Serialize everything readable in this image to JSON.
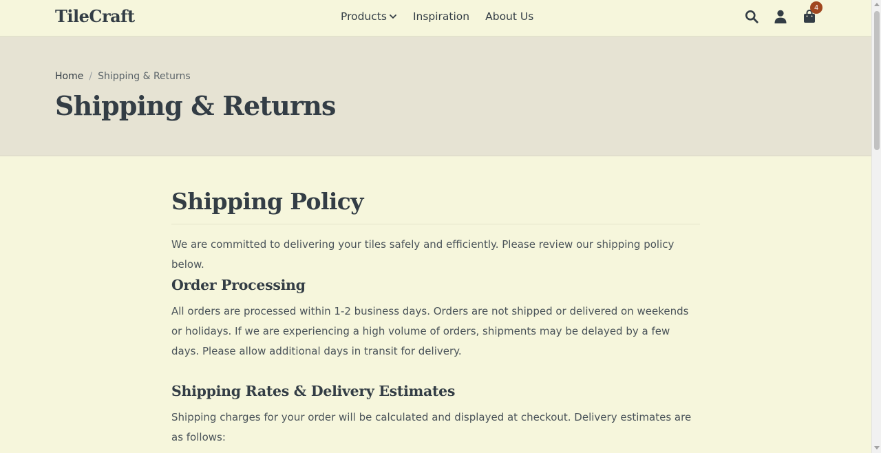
{
  "header": {
    "logo": "TileCraft",
    "nav": [
      "Products",
      "Inspiration",
      "About Us"
    ],
    "cart_count": "4",
    "icons": [
      "search-icon",
      "user-icon",
      "shopping-bag-icon",
      "chevron-down-icon"
    ]
  },
  "hero": {
    "breadcrumb": {
      "home": "Home",
      "separator": "/",
      "current": "Shipping & Returns"
    },
    "title": "Shipping & Returns"
  },
  "content": {
    "heading": "Shipping Policy",
    "intro": "We are committed to delivering your tiles safely and efficiently. Please review our shipping policy below.",
    "sections": [
      {
        "title": "Order Processing",
        "body": "All orders are processed within 1-2 business days. Orders are not shipped or delivered on weekends or holidays. If we are experiencing a high volume of orders, shipments may be delayed by a few days. Please allow additional days in transit for delivery."
      },
      {
        "title": "Shipping Rates & Delivery Estimates",
        "body": "Shipping charges for your order will be calculated and displayed at checkout. Delivery estimates are as follows:"
      }
    ]
  },
  "colors": {
    "page_bg": "#f6f6dc",
    "hero_bg": "#e6e3d3",
    "text": "#333d45",
    "badge": "#a0471f"
  }
}
